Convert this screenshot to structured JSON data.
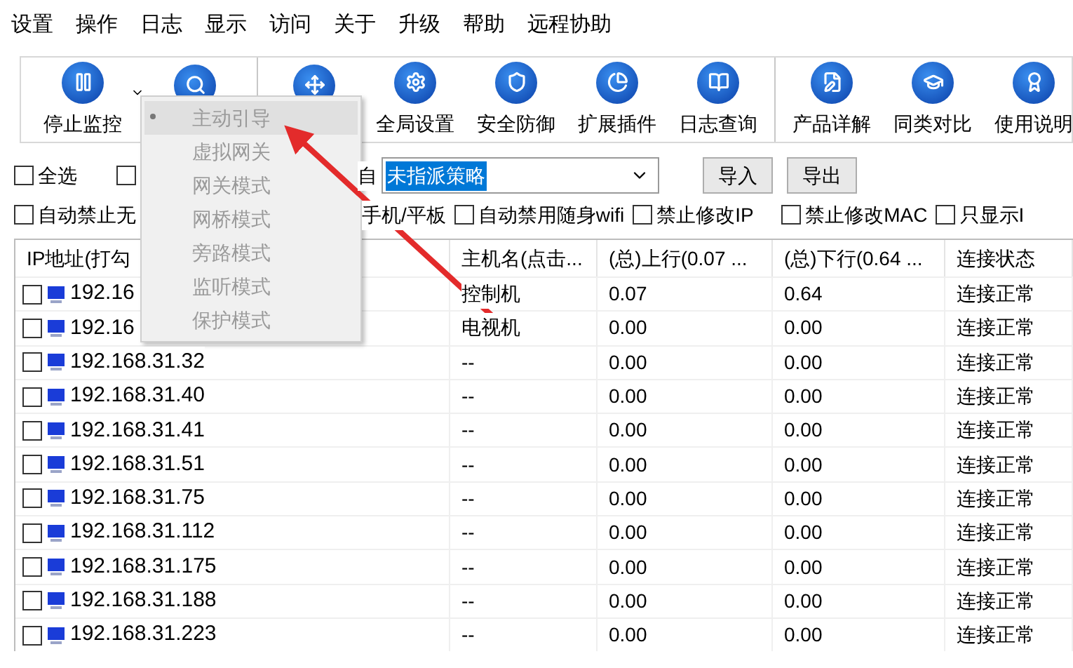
{
  "menu_bar": [
    "设置",
    "操作",
    "日志",
    "显示",
    "访问",
    "关于",
    "升级",
    "帮助",
    "远程协助"
  ],
  "toolbar": {
    "groups": [
      [
        {
          "label": "停止监控",
          "dropdown": true
        },
        {
          "dropdown": false
        }
      ],
      [
        {
          "dropdown": false
        },
        {
          "label": "全局设置",
          "dropdown": false
        },
        {
          "label": "安全防御",
          "dropdown": false
        },
        {
          "label": "扩展插件",
          "dropdown": false
        },
        {
          "label": "日志查询",
          "dropdown": false
        }
      ],
      [
        {
          "label": "产品详解",
          "dropdown": false
        },
        {
          "label": "同类对比",
          "dropdown": false
        },
        {
          "label": "使用说明",
          "dropdown": false
        }
      ]
    ]
  },
  "filter_row": {
    "checkboxes": [
      {
        "label": "全选",
        "checked": false
      },
      {
        "checked": false
      }
    ],
    "text": "自",
    "policy_select": {
      "value": "未指派策略"
    },
    "buttons": [
      "导入",
      "导出"
    ]
  },
  "options_row": [
    {
      "label": "自动禁止无",
      "checked": false
    },
    {
      "label": "手机/平板"
    },
    {
      "label": "自动禁用随身wifi",
      "checked": false
    },
    {
      "label": "禁止修改IP",
      "checked": false
    },
    {
      "label": "禁止修改MAC",
      "checked": false
    },
    {
      "label": "只显示I",
      "checked": false
    }
  ],
  "table": {
    "columns": [
      "IP地址(打勾",
      "主机名(点击...",
      "(总)上行(0.07 ...",
      "(总)下行(0.64 ...",
      "连接状态"
    ],
    "rows": [
      {
        "checked": false,
        "cells": [
          "192.16",
          "控制机",
          "0.07",
          "0.64",
          "连接正常"
        ]
      },
      {
        "checked": false,
        "cells": [
          "192.16",
          "电视机",
          "0.00",
          "0.00",
          "连接正常"
        ]
      },
      {
        "checked": false,
        "cells": [
          "192.168.31.32",
          "--",
          "0.00",
          "0.00",
          "连接正常"
        ]
      },
      {
        "checked": false,
        "cells": [
          "192.168.31.40",
          "--",
          "0.00",
          "0.00",
          "连接正常"
        ]
      },
      {
        "checked": false,
        "cells": [
          "192.168.31.41",
          "--",
          "0.00",
          "0.00",
          "连接正常"
        ]
      },
      {
        "checked": false,
        "cells": [
          "192.168.31.51",
          "--",
          "0.00",
          "0.00",
          "连接正常"
        ]
      },
      {
        "checked": false,
        "cells": [
          "192.168.31.75",
          "--",
          "0.00",
          "0.00",
          "连接正常"
        ]
      },
      {
        "checked": false,
        "cells": [
          "192.168.31.112",
          "--",
          "0.00",
          "0.00",
          "连接正常"
        ]
      },
      {
        "checked": false,
        "cells": [
          "192.168.31.175",
          "--",
          "0.00",
          "0.00",
          "连接正常"
        ]
      },
      {
        "checked": false,
        "cells": [
          "192.168.31.188",
          "--",
          "0.00",
          "0.00",
          "连接正常"
        ]
      },
      {
        "checked": false,
        "cells": [
          "192.168.31.223",
          "--",
          "0.00",
          "0.00",
          "连接正常"
        ]
      }
    ]
  },
  "mode_menu": [
    {
      "label": "主动引导",
      "selected": true,
      "disabled": true
    },
    {
      "label": "虚拟网关",
      "selected": false,
      "disabled": true
    },
    {
      "label": "网关模式",
      "selected": false,
      "disabled": true
    },
    {
      "label": "网桥模式",
      "selected": false,
      "disabled": true
    },
    {
      "label": "旁路模式",
      "selected": false,
      "disabled": true
    },
    {
      "label": "监听模式",
      "selected": false,
      "disabled": true
    },
    {
      "label": "保护模式",
      "selected": false,
      "disabled": true
    }
  ]
}
